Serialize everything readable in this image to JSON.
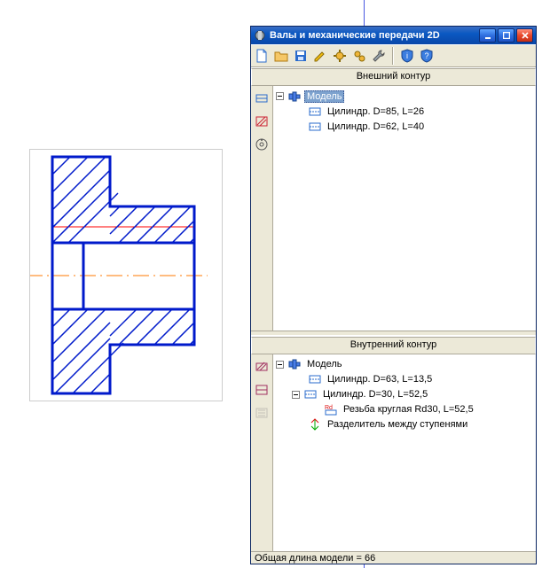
{
  "window": {
    "title": "Валы и механические передачи 2D"
  },
  "sections": {
    "outer": {
      "header": "Внешний контур"
    },
    "inner": {
      "header": "Внутренний контур"
    }
  },
  "tree_outer": {
    "root": "Модель",
    "items": [
      "Цилиндр. D=85, L=26",
      "Цилиндр. D=62, L=40"
    ]
  },
  "tree_inner": {
    "root": "Модель",
    "items": [
      "Цилиндр. D=63, L=13,5",
      "Цилиндр. D=30, L=52,5",
      "Резьба круглая Rd30, L=52,5",
      "Разделитель между ступенями"
    ]
  },
  "status": "Общая длина модели = 66"
}
